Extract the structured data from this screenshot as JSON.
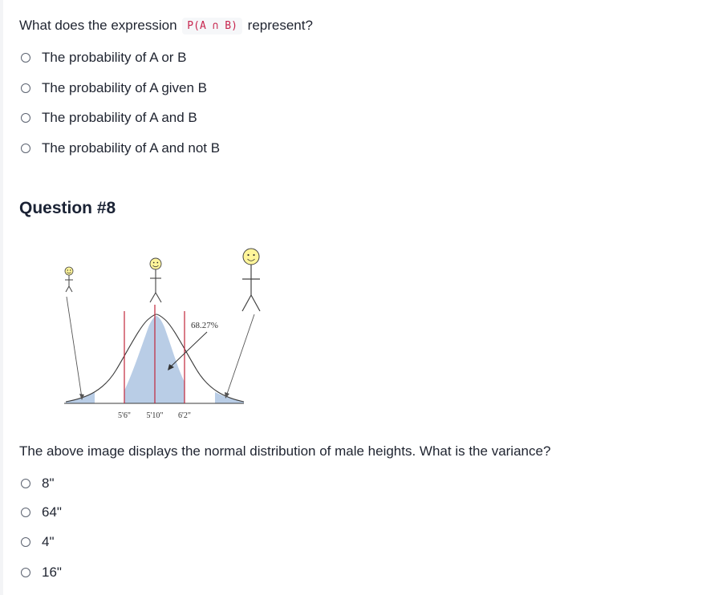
{
  "question7": {
    "text_before": "What does the expression",
    "code": "P(A ∩ B)",
    "text_after": "represent?",
    "options": [
      "The probability of A or B",
      "The probability of A given B",
      "The probability of A and B",
      "The probability of A and not B"
    ]
  },
  "question8": {
    "heading": "Question #8",
    "figure": {
      "percent_label": "68.27%",
      "tick_labels": [
        "5'6\"",
        "5'10\"",
        "6'2\""
      ]
    },
    "text": "The above image displays the normal distribution of male heights. What is the variance?",
    "options": [
      "8\"",
      "64\"",
      "4\"",
      "16\""
    ]
  }
}
